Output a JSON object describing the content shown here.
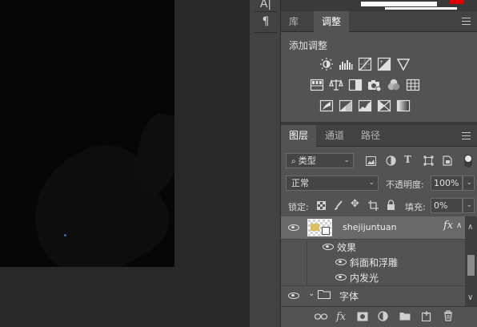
{
  "toolbar": {
    "char_label": "A|",
    "paragraph_label": "¶"
  },
  "panel_tabs": {
    "library": "库",
    "adjustments": "调整"
  },
  "adjustments": {
    "title": "添加调整",
    "row1": [
      "brightness-contrast-icon",
      "levels-icon",
      "curves-icon",
      "exposure-icon",
      "vibrance-icon"
    ],
    "row2": [
      "hue-saturation-icon",
      "color-balance-icon",
      "black-white-icon",
      "photo-filter-icon",
      "channel-mixer-icon",
      "color-lookup-icon"
    ],
    "row3": [
      "invert-icon",
      "posterize-icon",
      "threshold-icon",
      "selective-color-icon",
      "gradient-map-icon"
    ]
  },
  "layers_panel": {
    "tabs": [
      "图层",
      "通道",
      "路径"
    ],
    "filter_kind": "类型",
    "blend_mode": "正常",
    "opacity_label": "不透明度:",
    "opacity_value": "100%",
    "lock_label": "锁定:",
    "fill_label": "填充:",
    "fill_value": "0%",
    "layers": [
      {
        "name": "shejijuntuan",
        "fx": "fx"
      },
      {
        "name": "效果"
      },
      {
        "name": "斜面和浮雕"
      },
      {
        "name": "内发光"
      },
      {
        "name": "字体"
      }
    ]
  },
  "colors": {
    "panel_bg": "#535353",
    "dark_bg": "#282828",
    "selected_layer": "#696969",
    "accent_red": "#e00000"
  }
}
